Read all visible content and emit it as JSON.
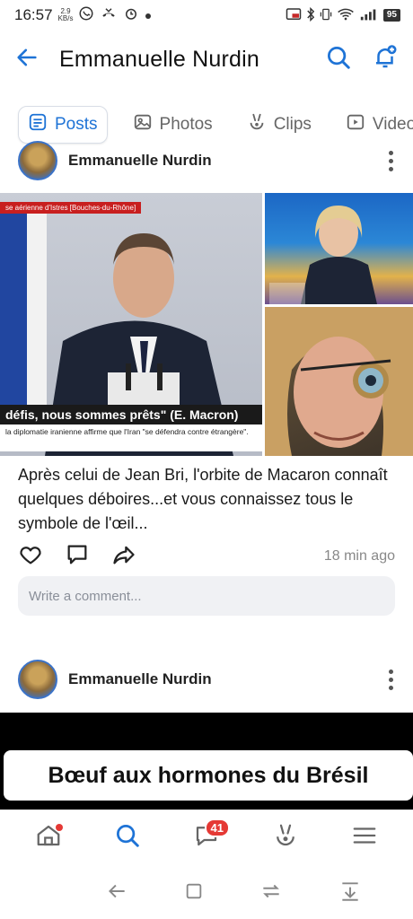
{
  "status_bar": {
    "time": "16:57",
    "speed_value": "2.9",
    "speed_unit": "KB/s",
    "battery": "95"
  },
  "header": {
    "title": "Emmanuelle Nurdin"
  },
  "tabs": [
    {
      "label": "Posts",
      "icon": "posts-icon",
      "active": true
    },
    {
      "label": "Photos",
      "icon": "photos-icon",
      "active": false
    },
    {
      "label": "Clips",
      "icon": "clips-icon",
      "active": false
    },
    {
      "label": "Videos",
      "icon": "videos-icon",
      "active": false
    }
  ],
  "post1": {
    "author": "Emmanuelle Nurdin",
    "media": {
      "chyron_top": "se aérienne d'Istres [Bouches-du-Rhône]",
      "banner": "défis, nous sommes prêts\" (E. Macron)",
      "banner_sub": "la diplomatie iranienne affirme que l'Iran \"se défendra contre étrangère\"."
    },
    "caption": "Après celui de Jean Bri, l'orbite de Macaron connaît quelques déboires...et vous connaissez tous le symbole de l'œil...",
    "time_ago": "18 min ago",
    "comment_placeholder": "Write a comment..."
  },
  "post2": {
    "author": "Emmanuelle Nurdin",
    "video_title": "Bœuf aux hormones du Brésil"
  },
  "bottom_nav": {
    "messages_badge": "41"
  },
  "colors": {
    "accent": "#1e73d6",
    "badge": "#e53935"
  }
}
